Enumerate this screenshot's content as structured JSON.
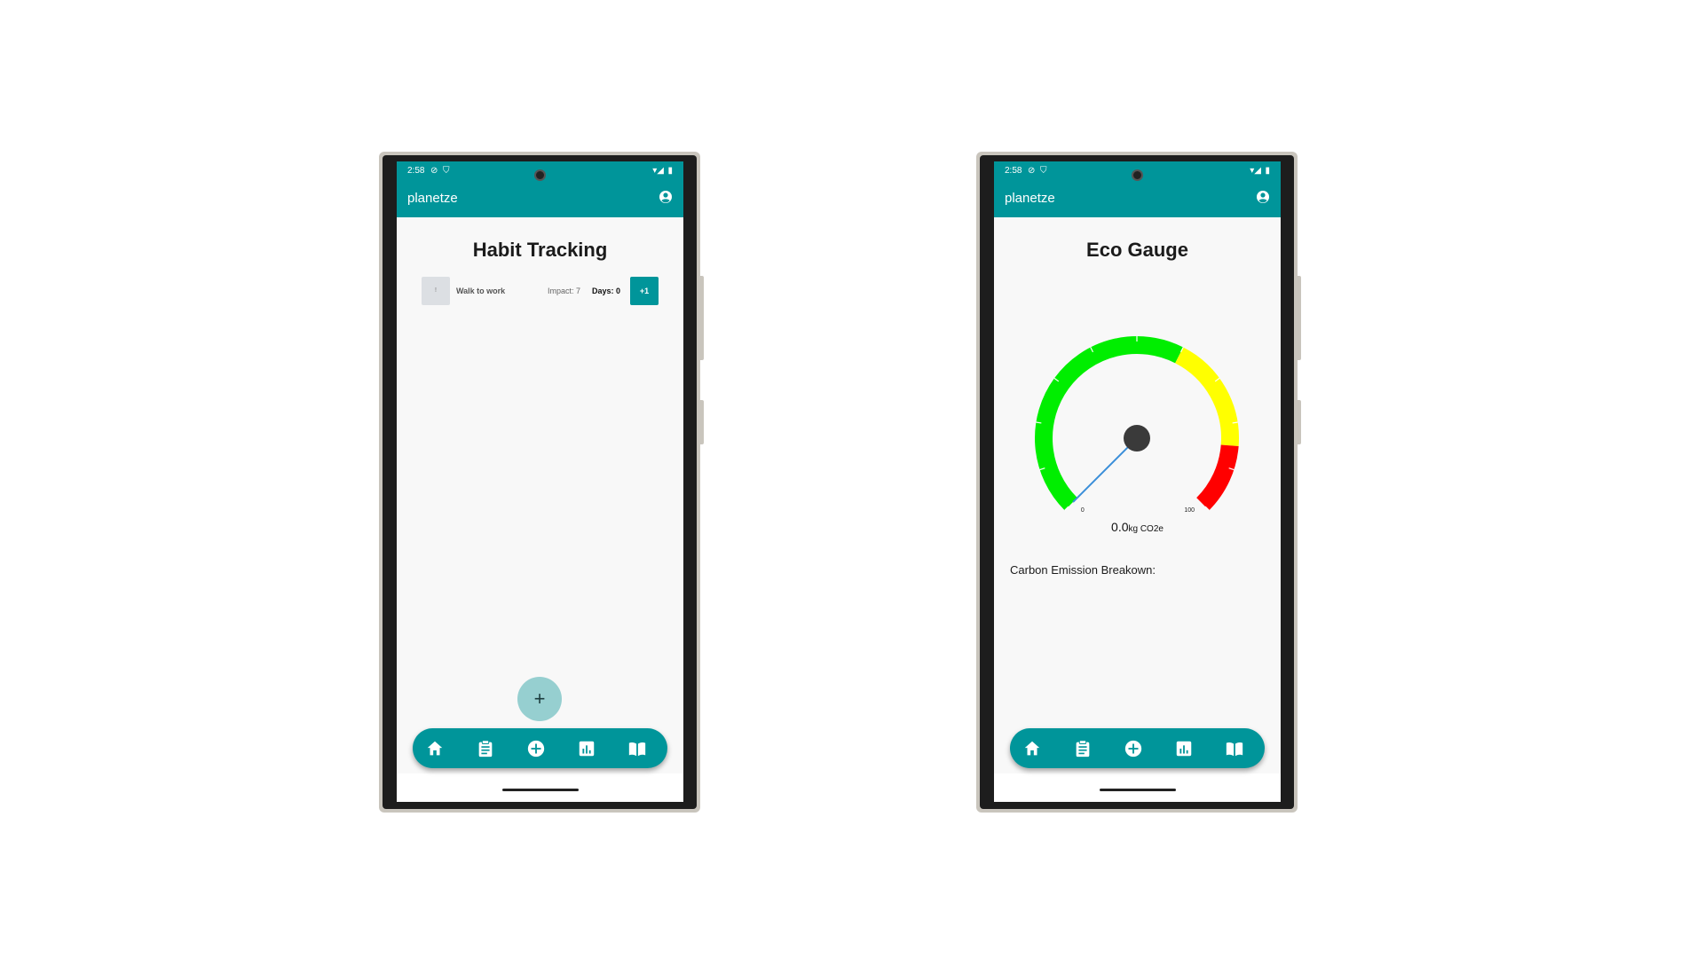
{
  "colors": {
    "brand": "#00959a",
    "fab": "#96cfd0",
    "gauge_green": "#00ee00",
    "gauge_yellow": "#ffff00",
    "gauge_red": "#ff0000",
    "needle": "#3b8fd9"
  },
  "status_bar": {
    "time": "2:58"
  },
  "app": {
    "title": "planetze"
  },
  "left_screen": {
    "title": "Habit Tracking",
    "habit": {
      "thumb_text": "!",
      "name": "Walk to work",
      "impact": "Impact: 7",
      "days": "Days: 0",
      "increment_label": "+1"
    },
    "fab_label": "+"
  },
  "right_screen": {
    "title": "Eco Gauge",
    "gauge": {
      "min_label": "0",
      "max_label": "100",
      "value": 0,
      "value_text": "0.0",
      "unit": "kg CO2e"
    },
    "breakdown_label": "Carbon Emission Breakown:"
  },
  "bottom_nav": {
    "items": [
      "home-icon",
      "clipboard-icon",
      "add-circle-icon",
      "bar-chart-icon",
      "book-icon"
    ]
  }
}
